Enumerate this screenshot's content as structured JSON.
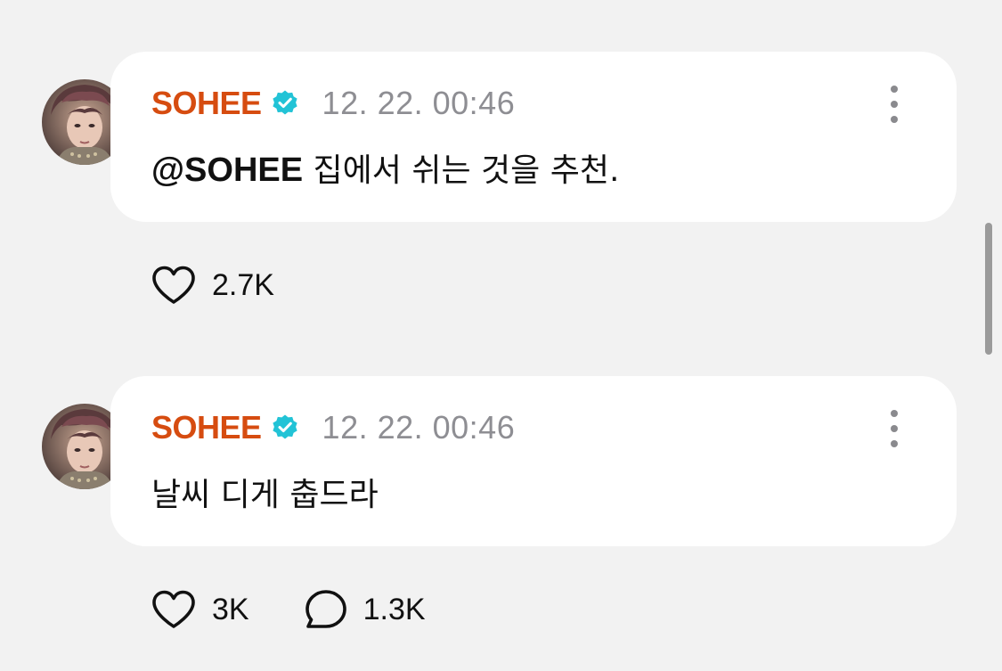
{
  "posts": [
    {
      "username": "SOHEE",
      "verified": true,
      "timestamp": "12. 22. 00:46",
      "mention": "@SOHEE",
      "text": " 집에서 쉬는 것을 추천.",
      "like_count": "2.7K"
    },
    {
      "username": "SOHEE",
      "verified": true,
      "timestamp": "12. 22. 00:46",
      "mention": "",
      "text": "날씨 디게 춥드라",
      "like_count": "3K",
      "reply_count": "1.3K"
    }
  ],
  "icons": {
    "verified": "verified-badge-icon",
    "more": "more-vertical-icon",
    "like": "heart-icon",
    "reply": "comment-bubble-icon"
  },
  "colors": {
    "username": "#d64c10",
    "verified_badge": "#22c3d6",
    "timestamp": "#8e8e93",
    "bubble_bg": "#ffffff",
    "page_bg": "#f2f2f2"
  }
}
